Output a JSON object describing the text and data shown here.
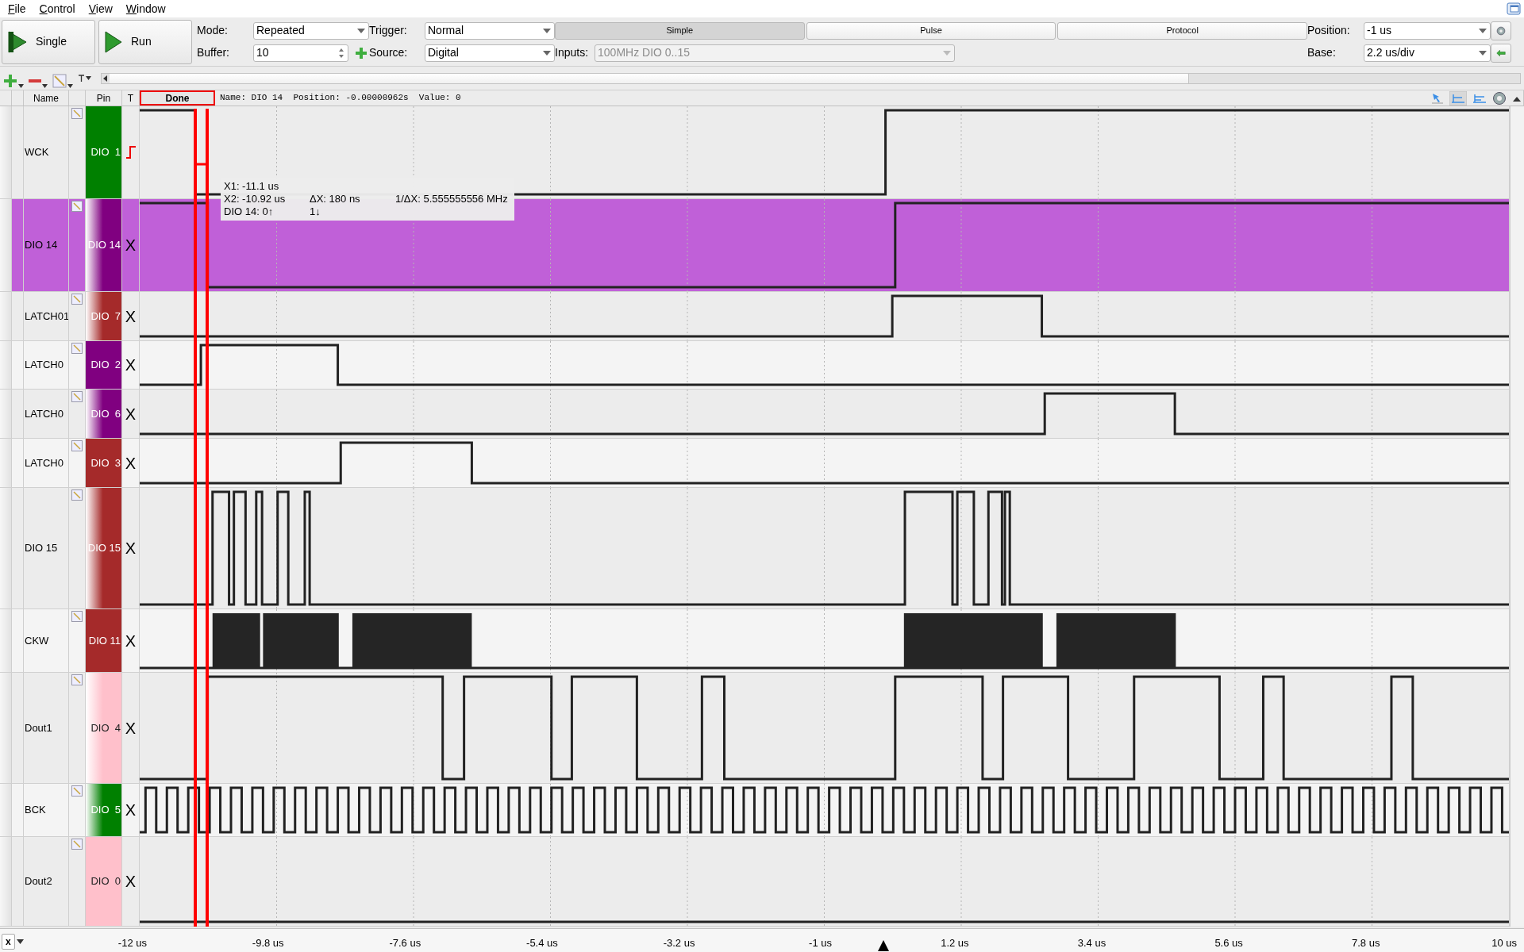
{
  "menu": [
    {
      "label": "File"
    },
    {
      "label": "Control"
    },
    {
      "label": "View"
    },
    {
      "label": "Window"
    }
  ],
  "toolbar": {
    "single_button": "Single",
    "run_button": "Run",
    "mode": {
      "label": "Mode:",
      "value": "Repeated"
    },
    "buffer": {
      "label": "Buffer:",
      "value": "10"
    },
    "trigger": {
      "label": "Trigger:",
      "value": "Normal"
    },
    "source": {
      "label": "Source:",
      "value": "Digital"
    },
    "tabs": [
      {
        "label": "Simple",
        "selected": true
      },
      {
        "label": "Pulse",
        "selected": false
      },
      {
        "label": "Protocol",
        "selected": false
      }
    ],
    "inputs": {
      "label": "Inputs:",
      "value": "100MHz DIO 0..15",
      "disabled": true
    },
    "position": {
      "label": "Position:",
      "value": "-1 us"
    },
    "base": {
      "label": "Base:",
      "value": "2.2 us/div"
    }
  },
  "columns": {
    "name": "Name",
    "pin": "Pin",
    "trigger": "T"
  },
  "status": {
    "text": "Done",
    "info": "Name: DIO 14  Position: -0.00000962s  Value: 0"
  },
  "signals": [
    {
      "name": "WCK",
      "pin": "DIO  1",
      "color": "#008000",
      "fade": false,
      "trigger": {
        "kind": "rising"
      },
      "selected": false
    },
    {
      "name": "DIO 14",
      "pin": "DIO 14",
      "color": "#800080",
      "fade": true,
      "trigger": {
        "kind": "text",
        "text": "X"
      },
      "selected": true
    },
    {
      "name": "LATCH01",
      "pin": "DIO  7",
      "color": "#a52a2a",
      "fade": true,
      "trigger": {
        "kind": "text",
        "text": "X"
      },
      "selected": false
    },
    {
      "name": "LATCH0",
      "pin": "DIO  2",
      "color": "#800080",
      "fade": false,
      "trigger": {
        "kind": "text",
        "text": "X"
      },
      "selected": false
    },
    {
      "name": "LATCH0",
      "pin": "DIO  6",
      "color": "#800080",
      "fade": true,
      "trigger": {
        "kind": "text",
        "text": "X"
      },
      "selected": false
    },
    {
      "name": "LATCH0",
      "pin": "DIO  3",
      "color": "#a52a2a",
      "fade": false,
      "trigger": {
        "kind": "text",
        "text": "X"
      },
      "selected": false
    },
    {
      "name": "DIO 15",
      "pin": "DIO 15",
      "color": "#a52a2a",
      "fade": true,
      "trigger": {
        "kind": "text",
        "text": "X"
      },
      "selected": false
    },
    {
      "name": "CKW",
      "pin": "DIO 11",
      "color": "#a52a2a",
      "fade": false,
      "trigger": {
        "kind": "text",
        "text": "X"
      },
      "selected": false
    },
    {
      "name": "Dout1",
      "pin": "DIO  4",
      "color": "#ffc0cb",
      "fade": true,
      "trigger": {
        "kind": "text",
        "text": "X"
      },
      "selected": false
    },
    {
      "name": "BCK",
      "pin": "DIO  5",
      "color": "#008000",
      "fade": true,
      "trigger": {
        "kind": "text",
        "text": "X"
      },
      "selected": false
    },
    {
      "name": "Dout2",
      "pin": "DIO  0",
      "color": "#ffc0cb",
      "fade": false,
      "trigger": {
        "kind": "text",
        "text": "X"
      },
      "selected": false
    }
  ],
  "cursor_readout": [
    [
      {
        "text": "X1: -11.1 us"
      }
    ],
    [
      {
        "text": "X2: -10.92 us"
      },
      {
        "text": "ΔX: 180 ns"
      },
      {
        "text": "1/ΔX: 5.555555556 MHz"
      }
    ],
    [
      {
        "text": "DIO 14:   0↑"
      },
      {
        "text": "1↓"
      }
    ]
  ],
  "axis": {
    "selector": "x",
    "ticks": [
      "-12 us",
      "-9.8 us",
      "-7.6 us",
      "-5.4 us",
      "-3.2 us",
      "-1 us",
      "1.2 us",
      "3.4 us",
      "5.6 us",
      "7.8 us",
      "10 us"
    ]
  }
}
